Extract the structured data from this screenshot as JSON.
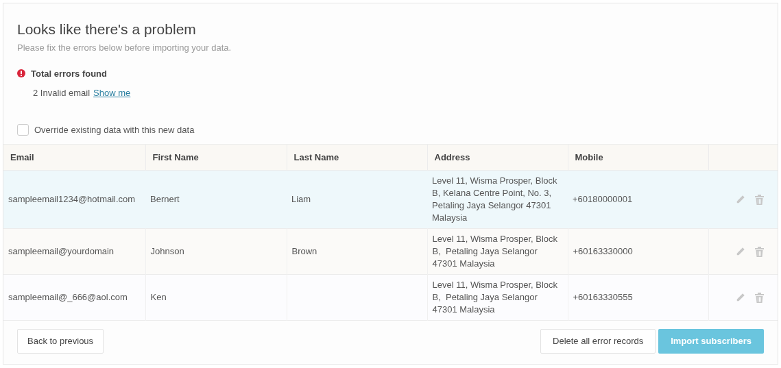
{
  "title": "Looks like there's a problem",
  "subtitle": "Please fix the errors below before importing your data.",
  "errors": {
    "heading": "Total errors found",
    "detail": "2 Invalid email",
    "link": "Show me"
  },
  "override": {
    "label": "Override existing data with this new data",
    "checked": false
  },
  "table": {
    "columns": [
      "Email",
      "First Name",
      "Last Name",
      "Address",
      "Mobile"
    ],
    "rows": [
      {
        "selected": true,
        "cells": [
          "sampleemail1234@hotmail.com",
          "Bernert",
          "Liam",
          "Level 11, Wisma Prosper, Block B, Kelana Centre Point, No. 3, Petaling Jaya Selangor 47301 Malaysia",
          "+60180000001"
        ]
      },
      {
        "selected": false,
        "cells": [
          "sampleemail@yourdomain",
          "Johnson",
          "Brown",
          "Level 11, Wisma Prosper, Block B,  Petaling Jaya Selangor 47301 Malaysia",
          "+60163330000"
        ]
      },
      {
        "selected": false,
        "cells": [
          "sampleemail@_666@aol.com",
          "Ken",
          "",
          "Level 11, Wisma Prosper, Block B,  Petaling Jaya Selangor 47301 Malaysia",
          "+60163330555"
        ]
      }
    ]
  },
  "buttons": {
    "back": "Back to previous",
    "delete": "Delete all error records",
    "import": {
      "label": "Import subscribers",
      "disabled": true
    }
  }
}
